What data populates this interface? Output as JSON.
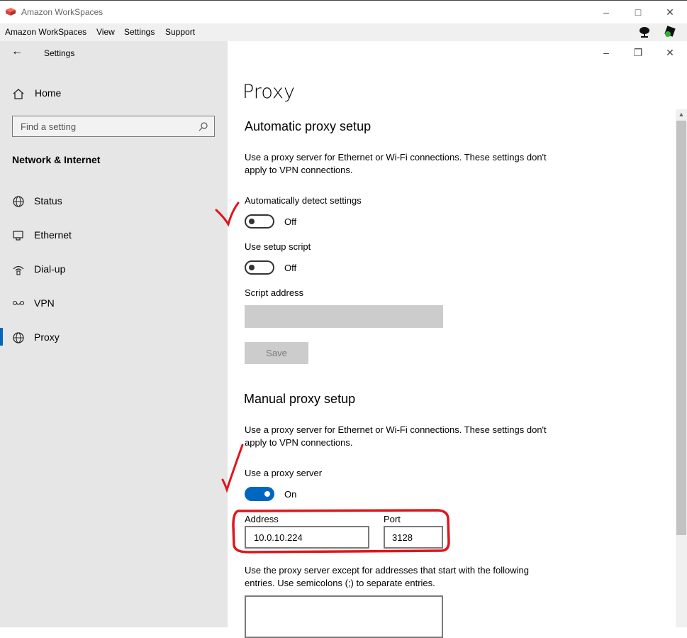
{
  "app": {
    "title": "Amazon WorkSpaces",
    "menu": [
      "Amazon WorkSpaces",
      "View",
      "Settings",
      "Support"
    ]
  },
  "settings_window": {
    "title": "Settings"
  },
  "sidebar": {
    "home_label": "Home",
    "search_placeholder": "Find a setting",
    "section_title": "Network & Internet",
    "items": [
      {
        "label": "Status",
        "icon": "globe-icon"
      },
      {
        "label": "Ethernet",
        "icon": "ethernet-icon"
      },
      {
        "label": "Dial-up",
        "icon": "dialup-icon"
      },
      {
        "label": "VPN",
        "icon": "vpn-icon"
      },
      {
        "label": "Proxy",
        "icon": "globe-icon",
        "selected": true
      }
    ]
  },
  "main": {
    "page_title": "Proxy",
    "automatic": {
      "heading": "Automatic proxy setup",
      "description": "Use a proxy server for Ethernet or Wi-Fi connections. These settings don't apply to VPN connections.",
      "auto_detect_label": "Automatically detect settings",
      "auto_detect_state": "Off",
      "setup_script_label": "Use setup script",
      "setup_script_state": "Off",
      "script_address_label": "Script address",
      "script_address_value": "",
      "save_label": "Save"
    },
    "manual": {
      "heading": "Manual proxy setup",
      "description": "Use a proxy server for Ethernet or Wi-Fi connections. These settings don't apply to VPN connections.",
      "use_proxy_label": "Use a proxy server",
      "use_proxy_state": "On",
      "address_label": "Address",
      "address_value": "10.0.10.224",
      "port_label": "Port",
      "port_value": "3128",
      "exceptions_description": "Use the proxy server except for addresses that start with the following entries. Use semicolons (;) to separate entries.",
      "exceptions_value": ""
    }
  },
  "colors": {
    "accent": "#0067c0",
    "annotation": "#e0151b",
    "sidebar_bg": "#e6e6e6"
  }
}
